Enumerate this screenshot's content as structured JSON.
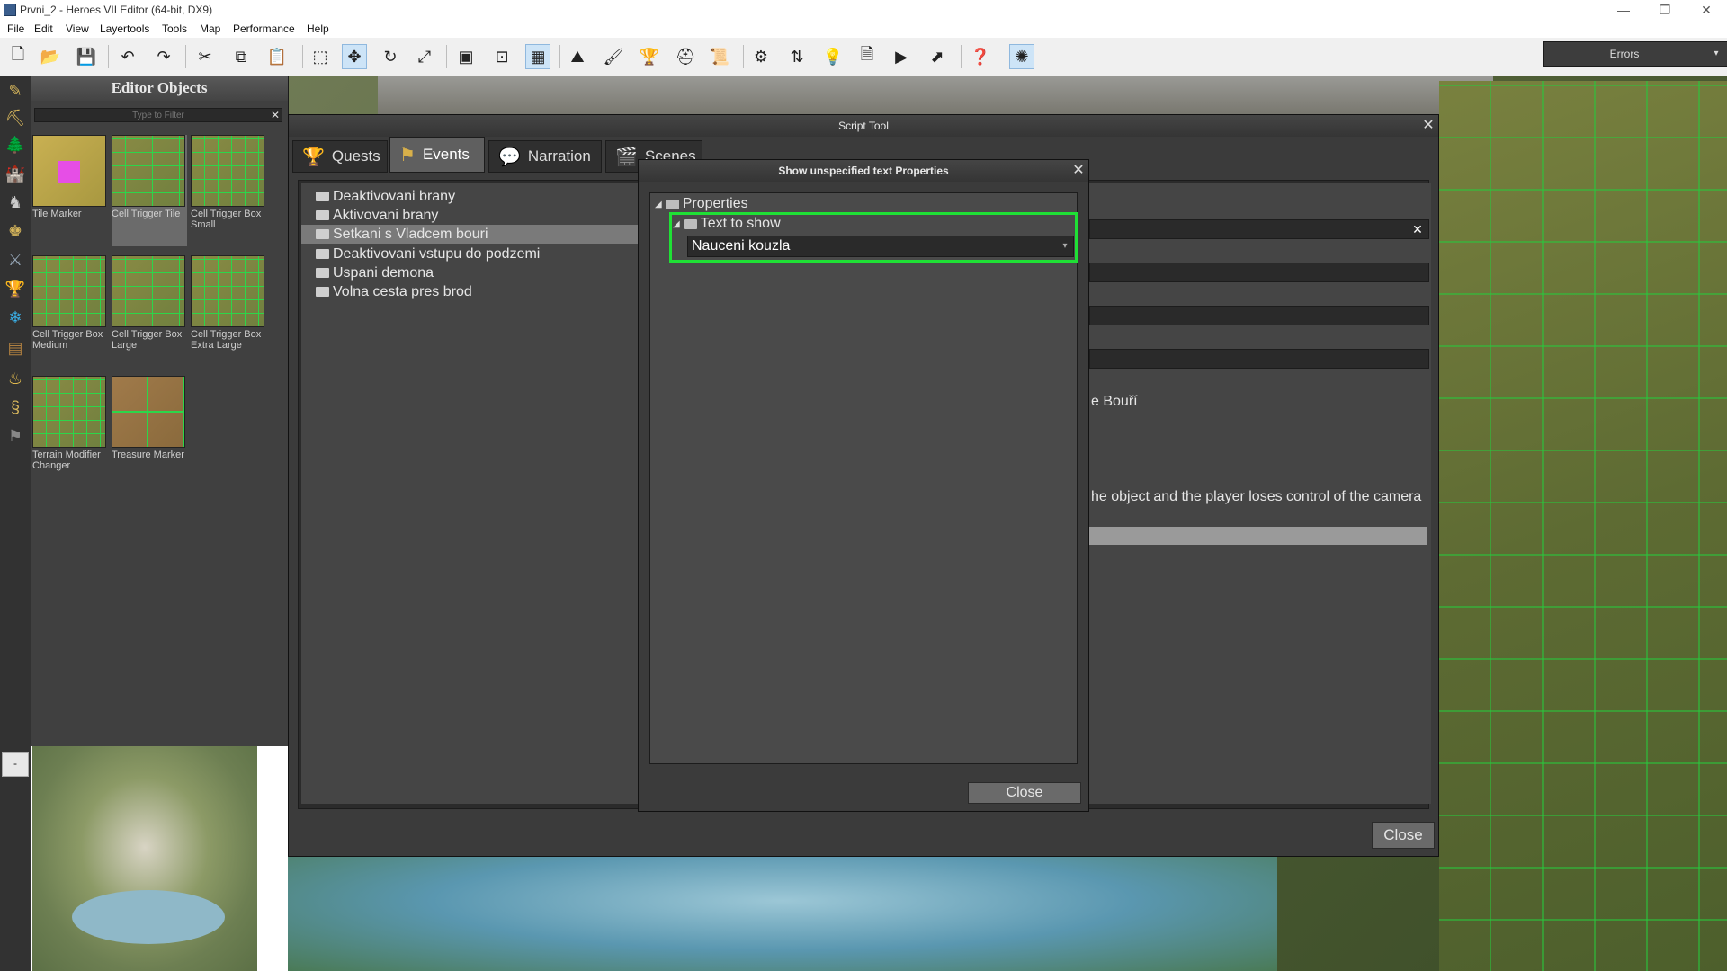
{
  "window": {
    "title": "Prvni_2 - Heroes VII Editor (64-bit, DX9)",
    "minimize": "—",
    "restore": "❐",
    "close": "✕"
  },
  "menu": [
    "File",
    "Edit",
    "View",
    "Layertools",
    "Tools",
    "Map",
    "Performance",
    "Help"
  ],
  "toolbar": {
    "errors_label": "Errors",
    "errors_arrow": "▾"
  },
  "editor_objects": {
    "title": "Editor Objects",
    "filter_placeholder": "Type to Filter",
    "filter_clear": "✕",
    "items": [
      "Tile Marker",
      "Cell Trigger Tile",
      "Cell Trigger Box Small",
      "Cell Trigger Box Medium",
      "Cell Trigger Box Large",
      "Cell Trigger Box Extra Large",
      "Terrain Modifier Changer",
      "Treasure Marker"
    ]
  },
  "minimap": {
    "toggle_label": "-"
  },
  "script_tool": {
    "title": "Script Tool",
    "close_x": "✕",
    "tabs": [
      "Quests",
      "Events",
      "Narration",
      "Scenes"
    ],
    "active_tab": "Events",
    "events": [
      "Deaktivovani brany",
      "Aktivovani brany",
      "Setkani s Vladcem bouri",
      "Deaktivovani vstupu do podzemi",
      "Uspani demona",
      "Volna cesta pres brod"
    ],
    "selected_event": "Setkani s Vladcem bouri",
    "right_text_1": "e Bouří",
    "right_text_2": "he object and the player loses control of the camera",
    "field_clear": "✕",
    "close_label": "Close"
  },
  "properties_dialog": {
    "title": "Show unspecified text Properties",
    "close_x": "✕",
    "root_label": "Properties",
    "child_label": "Text to show",
    "combo_value": "Nauceni kouzla",
    "combo_arrow": "▾",
    "close_label": "Close"
  },
  "colors": {
    "highlight_green": "#1fe035",
    "panel_dark": "#3b3b3b",
    "selected_row": "#7a7a7a"
  }
}
